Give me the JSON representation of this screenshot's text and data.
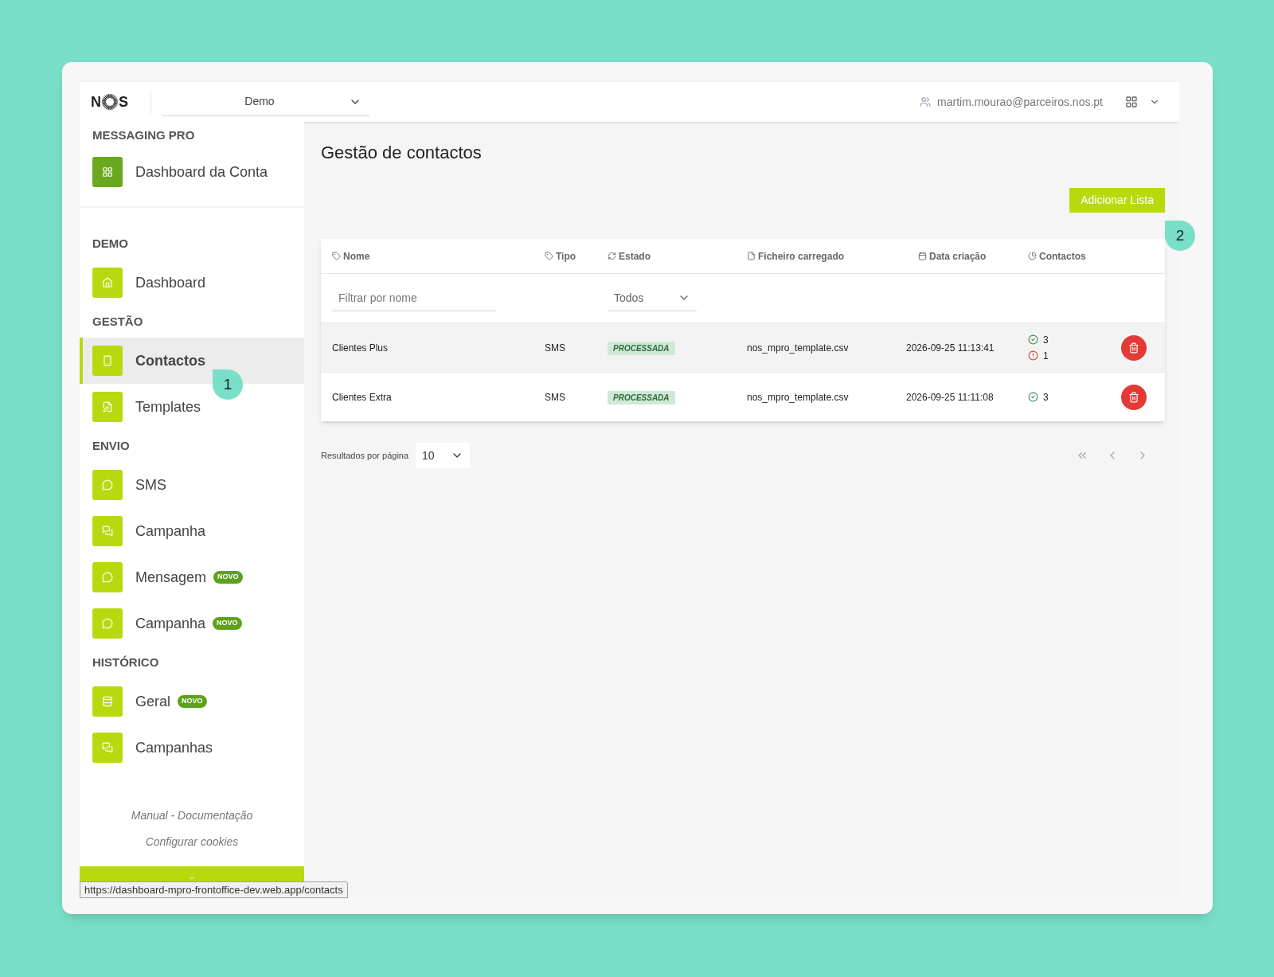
{
  "header": {
    "logo_left": "N",
    "logo_right": "S",
    "account_select": {
      "value": "Demo"
    },
    "user_email": "martim.mourao@parceiros.nos.pt"
  },
  "sidebar": {
    "sections": [
      {
        "title": "MESSAGING PRO",
        "items": [
          {
            "label": "Dashboard da Conta",
            "color": "#6aa81e",
            "selected": false
          }
        ]
      },
      {
        "title": "DEMO",
        "items": [
          {
            "label": "Dashboard",
            "color": "#b8d90d",
            "selected": false
          }
        ]
      },
      {
        "title": "GESTÃO",
        "items": [
          {
            "label": "Contactos",
            "color": "#b8d90d",
            "selected": true
          },
          {
            "label": "Templates",
            "color": "#b8d90d",
            "selected": false
          }
        ]
      },
      {
        "title": "ENVIO",
        "items": [
          {
            "label": "SMS",
            "color": "#b8d90d",
            "selected": false
          },
          {
            "label": "Campanha",
            "color": "#b8d90d",
            "selected": false
          },
          {
            "label": "Mensagem",
            "color": "#b8d90d",
            "selected": false,
            "badge": "NOVO"
          },
          {
            "label": "Campanha",
            "color": "#b8d90d",
            "selected": false,
            "badge": "NOVO"
          }
        ]
      },
      {
        "title": "HISTÓRICO",
        "items": [
          {
            "label": "Geral",
            "color": "#b8d90d",
            "selected": false,
            "badge": "NOVO"
          },
          {
            "label": "Campanhas",
            "color": "#b8d90d",
            "selected": false
          }
        ]
      }
    ],
    "footer_links": [
      "Manual - Documentação",
      "Configurar cookies"
    ]
  },
  "page": {
    "title": "Gestão de contactos",
    "add_button": "Adicionar Lista"
  },
  "table": {
    "columns": [
      {
        "label": "Nome"
      },
      {
        "label": "Tipo"
      },
      {
        "label": "Estado"
      },
      {
        "label": "Ficheiro carregado"
      },
      {
        "label": "Data criação"
      },
      {
        "label": "Contactos"
      }
    ],
    "filter": {
      "placeholder": "Filtrar por nome"
    },
    "status_select": {
      "value": "Todos"
    },
    "rows": [
      {
        "name": "Clientes Plus",
        "type": "SMS",
        "status": "PROCESSADA",
        "file": "nos_mpro_template.csv",
        "date": "2026-09-25 11:13:41",
        "contacts": [
          {
            "kind": "ok",
            "count": "3"
          },
          {
            "kind": "error",
            "count": "1"
          }
        ],
        "selected": true
      },
      {
        "name": "Clientes Extra",
        "type": "SMS",
        "status": "PROCESSADA",
        "file": "nos_mpro_template.csv",
        "date": "2026-09-25 11:11:08",
        "contacts": [
          {
            "kind": "ok",
            "count": "3"
          }
        ],
        "selected": false
      }
    ]
  },
  "pagination": {
    "label": "Resultados por página",
    "value": "10"
  },
  "annotations": [
    {
      "label": "1"
    },
    {
      "label": "2"
    }
  ],
  "status_url": "https://dashboard-mpro-frontoffice-dev.web.app/contacts"
}
